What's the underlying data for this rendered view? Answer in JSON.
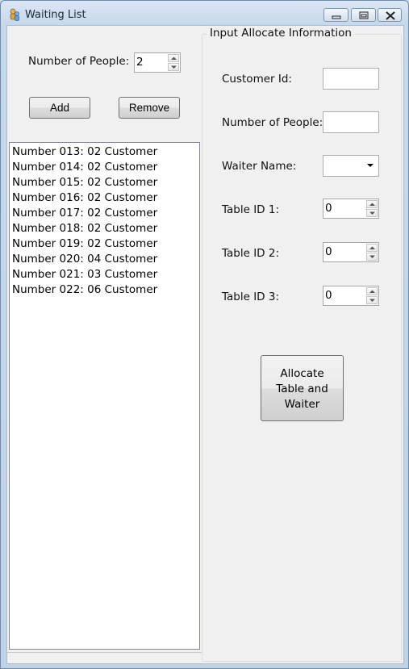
{
  "window": {
    "title": "Waiting List",
    "app_icon": "people-icon",
    "controls": [
      "minimize-icon",
      "restore-icon",
      "close-icon"
    ]
  },
  "left": {
    "people_label": "Number of People:",
    "people_value": "2",
    "add_label": "Add",
    "remove_label": "Remove",
    "waiting_list": [
      "Number 013:  02 Customer",
      "Number 014:  02 Customer",
      "Number 015:  02 Customer",
      "Number 016:  02 Customer",
      "Number 017:  02 Customer",
      "Number 018:  02 Customer",
      "Number 019:  02 Customer",
      "Number 020:  04 Customer",
      "Number 021:  03 Customer",
      "Number 022:  06 Customer"
    ]
  },
  "allocate": {
    "group_title": "Input Allocate Information",
    "customer_id_label": "Customer Id:",
    "customer_id_value": "",
    "people_label": "Number of People:",
    "people_value": "",
    "waiter_label": "Waiter Name:",
    "waiter_value": "",
    "table1_label": "Table ID 1:",
    "table1_value": "0",
    "table2_label": "Table ID 2:",
    "table2_value": "0",
    "table3_label": "Table ID 3:",
    "table3_value": "0",
    "button_line1": "Allocate",
    "button_line2": "Table and",
    "button_line3": "Waiter"
  }
}
